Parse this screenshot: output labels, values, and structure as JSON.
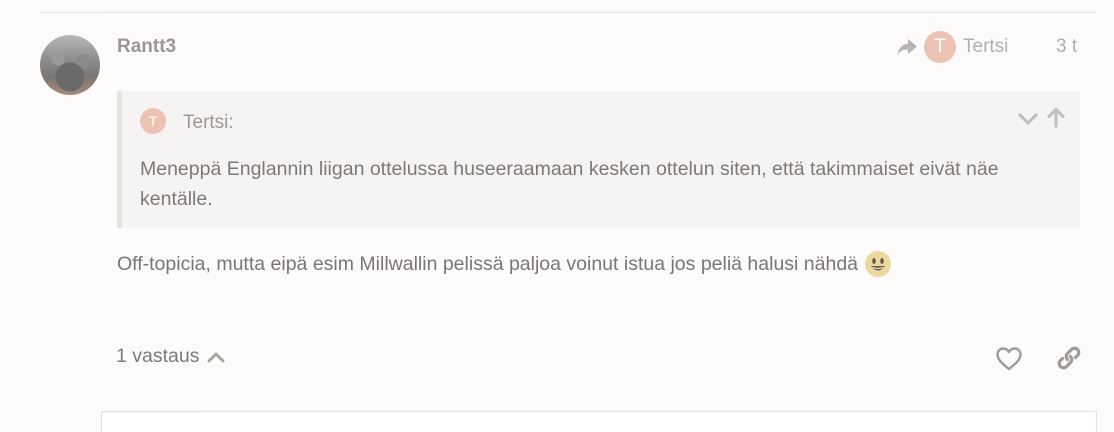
{
  "post": {
    "username": "Rantt3",
    "date": "3 t",
    "reply_to": {
      "avatar_letter": "T",
      "name": "Tertsi"
    },
    "quote": {
      "avatar_letter": "T",
      "author": "Tertsi:",
      "text": "Meneppä Englannin liigan ottelussa huseeraamaan kesken ottelun siten, että takimmaiset eivät näe kentälle."
    },
    "body": "Off-topicia, mutta eipä esim Millwallin pelissä paljoa voinut istua jos peliä halusi nähdä",
    "emoji": "smiley-icon"
  },
  "actions": {
    "replies_label": "1 vastaus",
    "like": "heart-icon",
    "link": "link-icon"
  },
  "colors": {
    "background": "#fcfbfa",
    "avatar_letter_bg": "#ecc3b2",
    "quote_bg": "#f6f4f2",
    "text": "#7a7674"
  }
}
